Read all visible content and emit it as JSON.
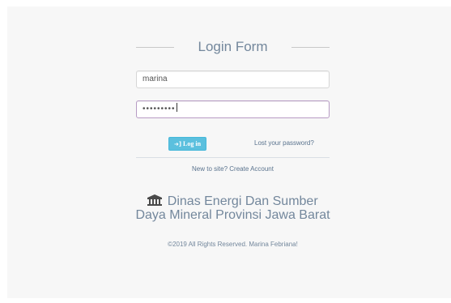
{
  "form": {
    "title": "Login Form",
    "username_value": "marina",
    "password_masked": "•••••••••",
    "login_label": "Log in",
    "login_icon": "sign-in-icon",
    "lost_password": "Lost your password?",
    "new_site_prefix": "New to site?",
    "create_account": "Create Account"
  },
  "org": {
    "icon": "institution-icon",
    "line1": "Dinas Energi Dan Sumber",
    "line2": "Daya Mineral Provinsi Jawa Barat"
  },
  "footer": {
    "copyright": "©2019 All Rights Reserved. Marina Febriana!"
  },
  "colors": {
    "page_bg": "#f7f7f7",
    "button": "#5bc0de",
    "text": "#73879c",
    "link": "#5a738e"
  }
}
